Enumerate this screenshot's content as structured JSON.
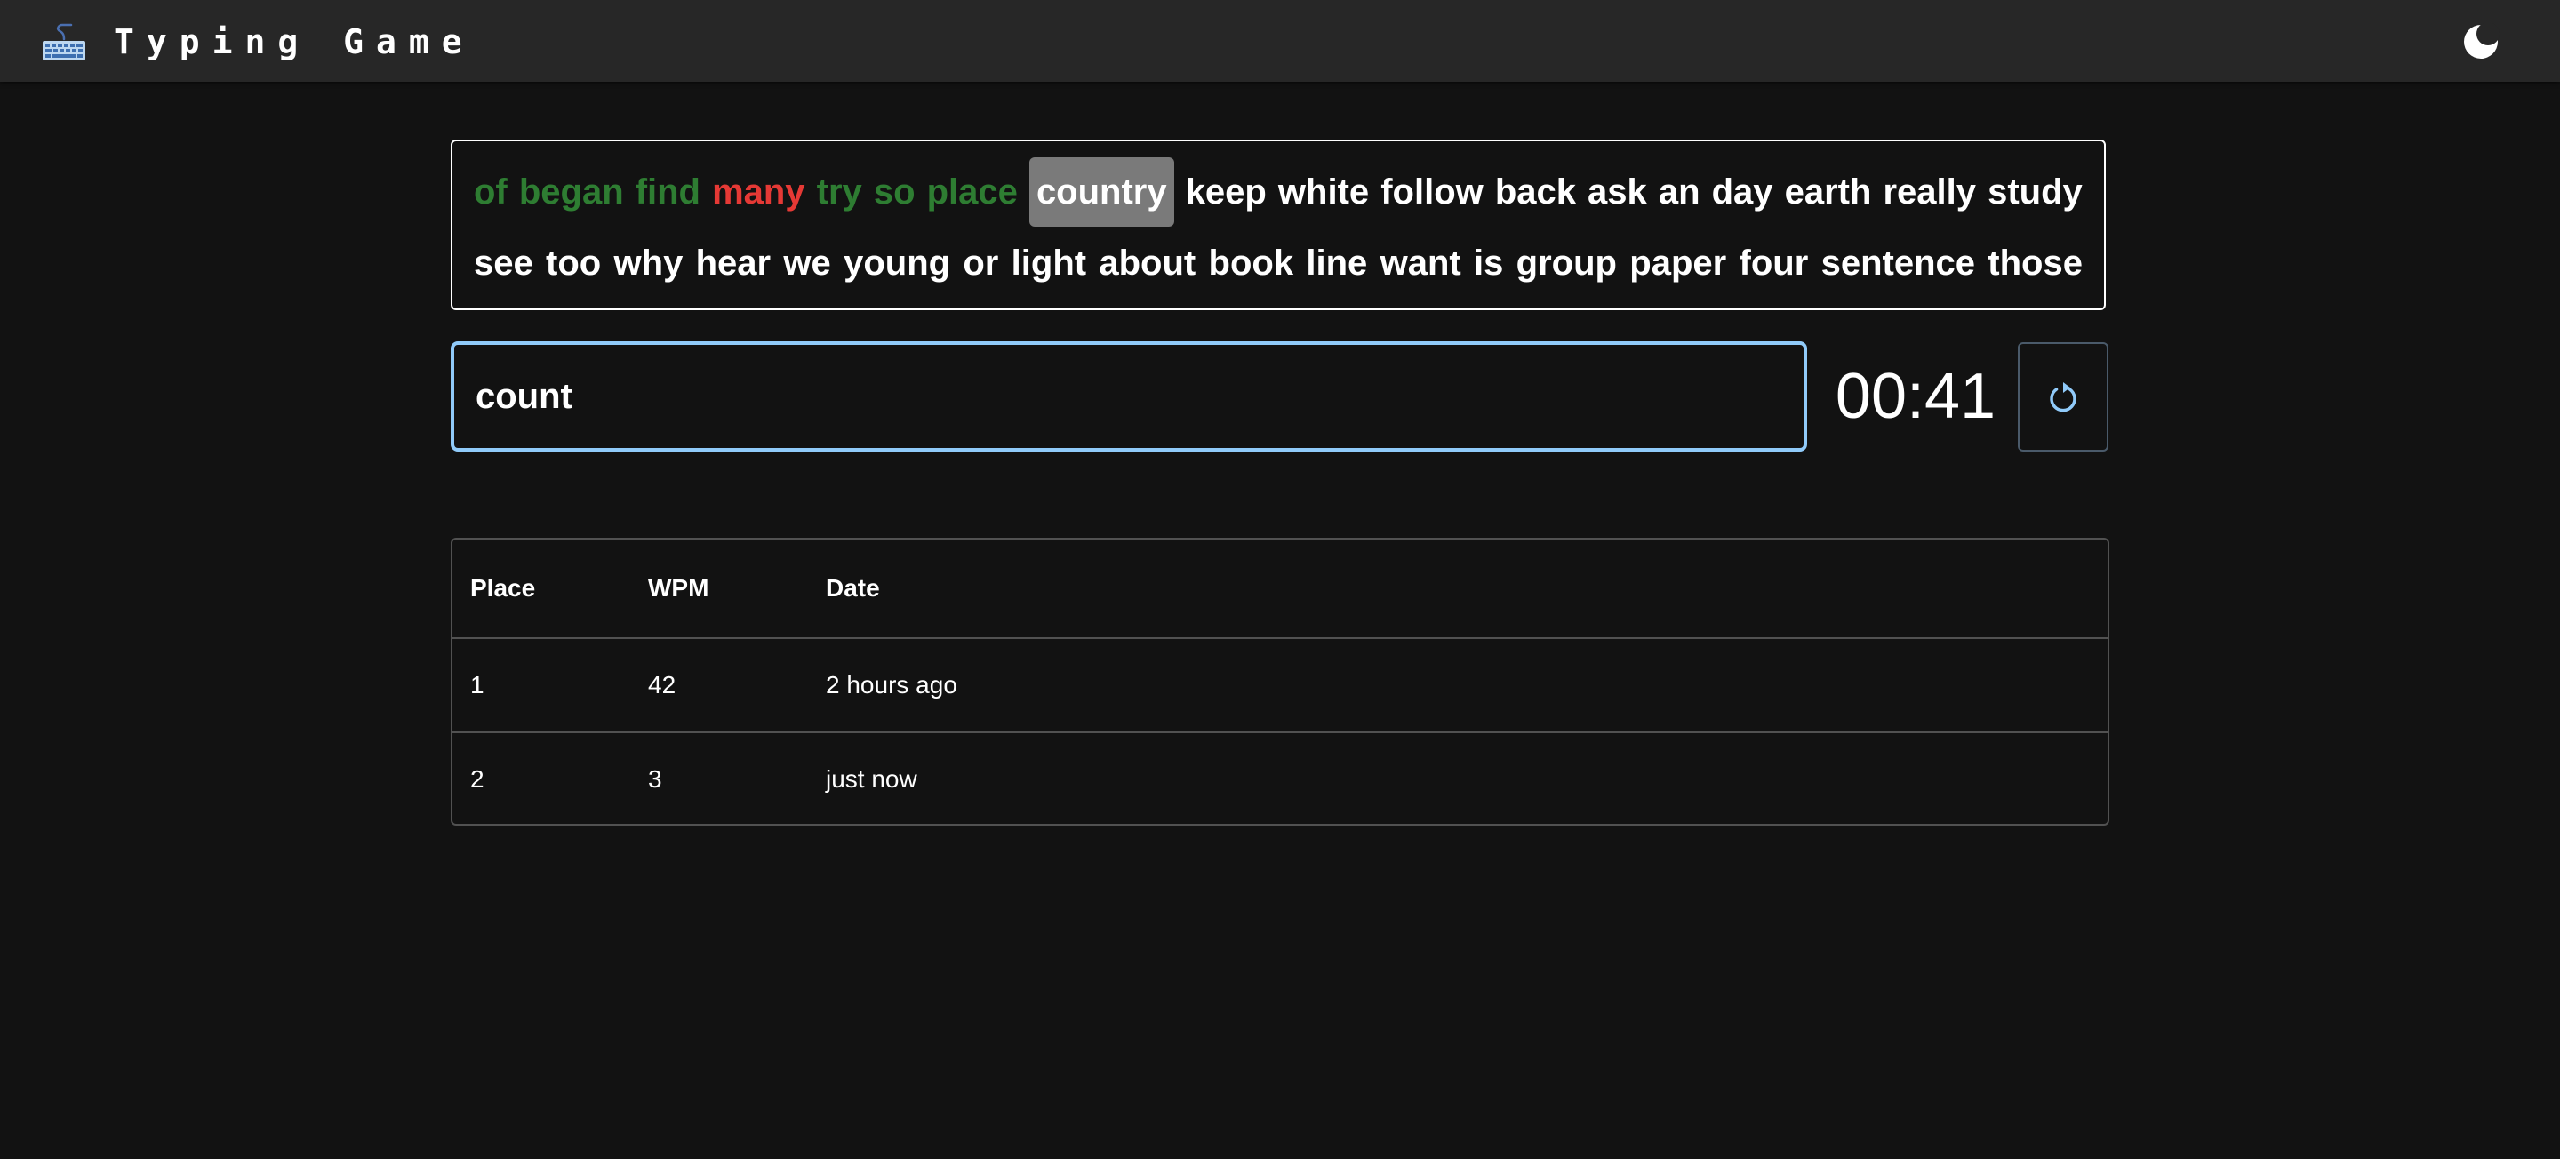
{
  "app": {
    "title": "Typing Game",
    "brand_icon": "keyboard-icon",
    "theme_icon": "moon-icon"
  },
  "colors": {
    "background": "#121212",
    "navbar": "#272727",
    "correct": "#2e7d32",
    "incorrect": "#e53935",
    "current_highlight": "#7a7a7a",
    "accent": "#90caf9"
  },
  "words": {
    "line1": [
      {
        "text": "of",
        "status": "correct"
      },
      {
        "text": "began",
        "status": "correct"
      },
      {
        "text": "find",
        "status": "correct"
      },
      {
        "text": "many",
        "status": "incorrect"
      },
      {
        "text": "try",
        "status": "correct"
      },
      {
        "text": "so",
        "status": "correct"
      },
      {
        "text": "place",
        "status": "correct"
      },
      {
        "text": "country",
        "status": "current"
      },
      {
        "text": "keep",
        "status": "pending"
      },
      {
        "text": "white",
        "status": "pending"
      },
      {
        "text": "follow",
        "status": "pending"
      },
      {
        "text": "back",
        "status": "pending"
      },
      {
        "text": "ask",
        "status": "pending"
      },
      {
        "text": "an",
        "status": "pending"
      },
      {
        "text": "day",
        "status": "pending"
      },
      {
        "text": "earth",
        "status": "pending"
      },
      {
        "text": "really",
        "status": "pending"
      },
      {
        "text": "study",
        "status": "pending"
      }
    ],
    "line2": [
      {
        "text": "see",
        "status": "pending"
      },
      {
        "text": "too",
        "status": "pending"
      },
      {
        "text": "why",
        "status": "pending"
      },
      {
        "text": "hear",
        "status": "pending"
      },
      {
        "text": "we",
        "status": "pending"
      },
      {
        "text": "young",
        "status": "pending"
      },
      {
        "text": "or",
        "status": "pending"
      },
      {
        "text": "light",
        "status": "pending"
      },
      {
        "text": "about",
        "status": "pending"
      },
      {
        "text": "book",
        "status": "pending"
      },
      {
        "text": "line",
        "status": "pending"
      },
      {
        "text": "want",
        "status": "pending"
      },
      {
        "text": "is",
        "status": "pending"
      },
      {
        "text": "group",
        "status": "pending"
      },
      {
        "text": "paper",
        "status": "pending"
      },
      {
        "text": "four",
        "status": "pending"
      },
      {
        "text": "sentence",
        "status": "pending"
      },
      {
        "text": "those",
        "status": "pending"
      }
    ]
  },
  "input": {
    "value": "count"
  },
  "timer": {
    "display": "00:41"
  },
  "restart": {
    "icon": "restart-icon"
  },
  "scores": {
    "headers": [
      "Place",
      "WPM",
      "Date"
    ],
    "rows": [
      [
        "1",
        "42",
        "2 hours ago"
      ],
      [
        "2",
        "3",
        "just now"
      ]
    ]
  }
}
